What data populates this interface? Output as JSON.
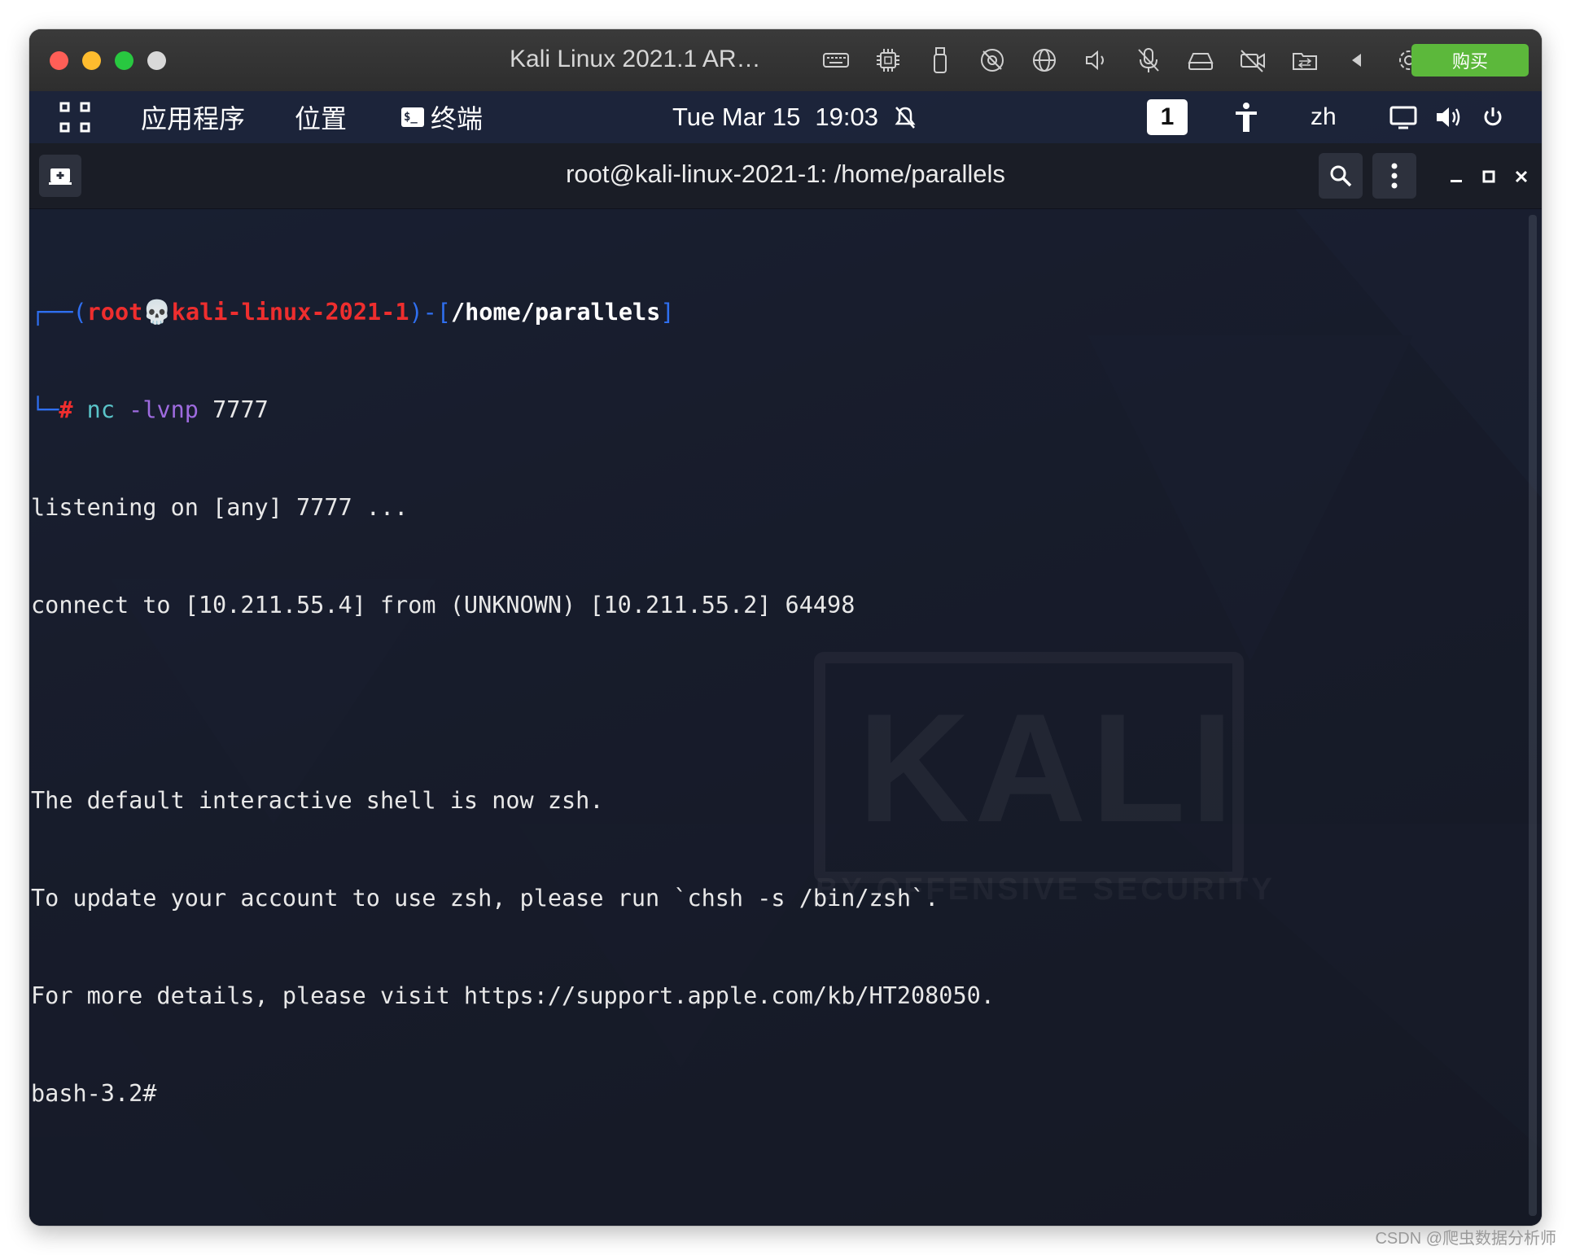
{
  "mac_window": {
    "title": "Kali Linux 2021.1 AR…",
    "buy_label": "购买",
    "toolbar_icons": [
      "keyboard-icon",
      "cpu-icon",
      "usb-icon",
      "camera-off-icon",
      "globe-icon",
      "speaker-icon",
      "microphone-off-icon",
      "drive-icon",
      "video-off-icon",
      "shared-folder-icon",
      "back-arrow-icon",
      "gear-icon"
    ]
  },
  "gnome_panel": {
    "applications": "应用程序",
    "places": "位置",
    "terminal": "终端",
    "terminal_icon_text": "$_",
    "date": "Tue Mar 15",
    "time": "19:03",
    "workspace": "1",
    "language": "zh"
  },
  "terminal": {
    "title": "root@kali-linux-2021-1: /home/parallels",
    "prompt": {
      "open": "┌──(",
      "user": "root",
      "skull": "💀",
      "host": "kali-linux-2021-1",
      "mid": ")-[",
      "path": "/home/parallels",
      "close": "]",
      "corner": "└─",
      "hash": "#",
      "cmd": "nc",
      "flag": "-lvnp",
      "port": "7777"
    },
    "output": [
      "listening on [any] 7777 ...",
      "connect to [10.211.55.4] from (UNKNOWN) [10.211.55.2] 64498",
      "",
      "The default interactive shell is now zsh.",
      "To update your account to use zsh, please run `chsh -s /bin/zsh`.",
      "For more details, please visit https://support.apple.com/kb/HT208050.",
      "bash-3.2#"
    ]
  },
  "watermark": {
    "logo": "KALI",
    "tagline": "BY OFFENSIVE SECURITY"
  },
  "footer": "CSDN @爬虫数据分析师",
  "colors": {
    "buy": "#5cb83b",
    "prompt_red": "#ee2e2e",
    "prompt_blue": "#2f6ff0",
    "cmd_teal": "#5ac4c9",
    "flag_purple": "#9e6bdf"
  }
}
